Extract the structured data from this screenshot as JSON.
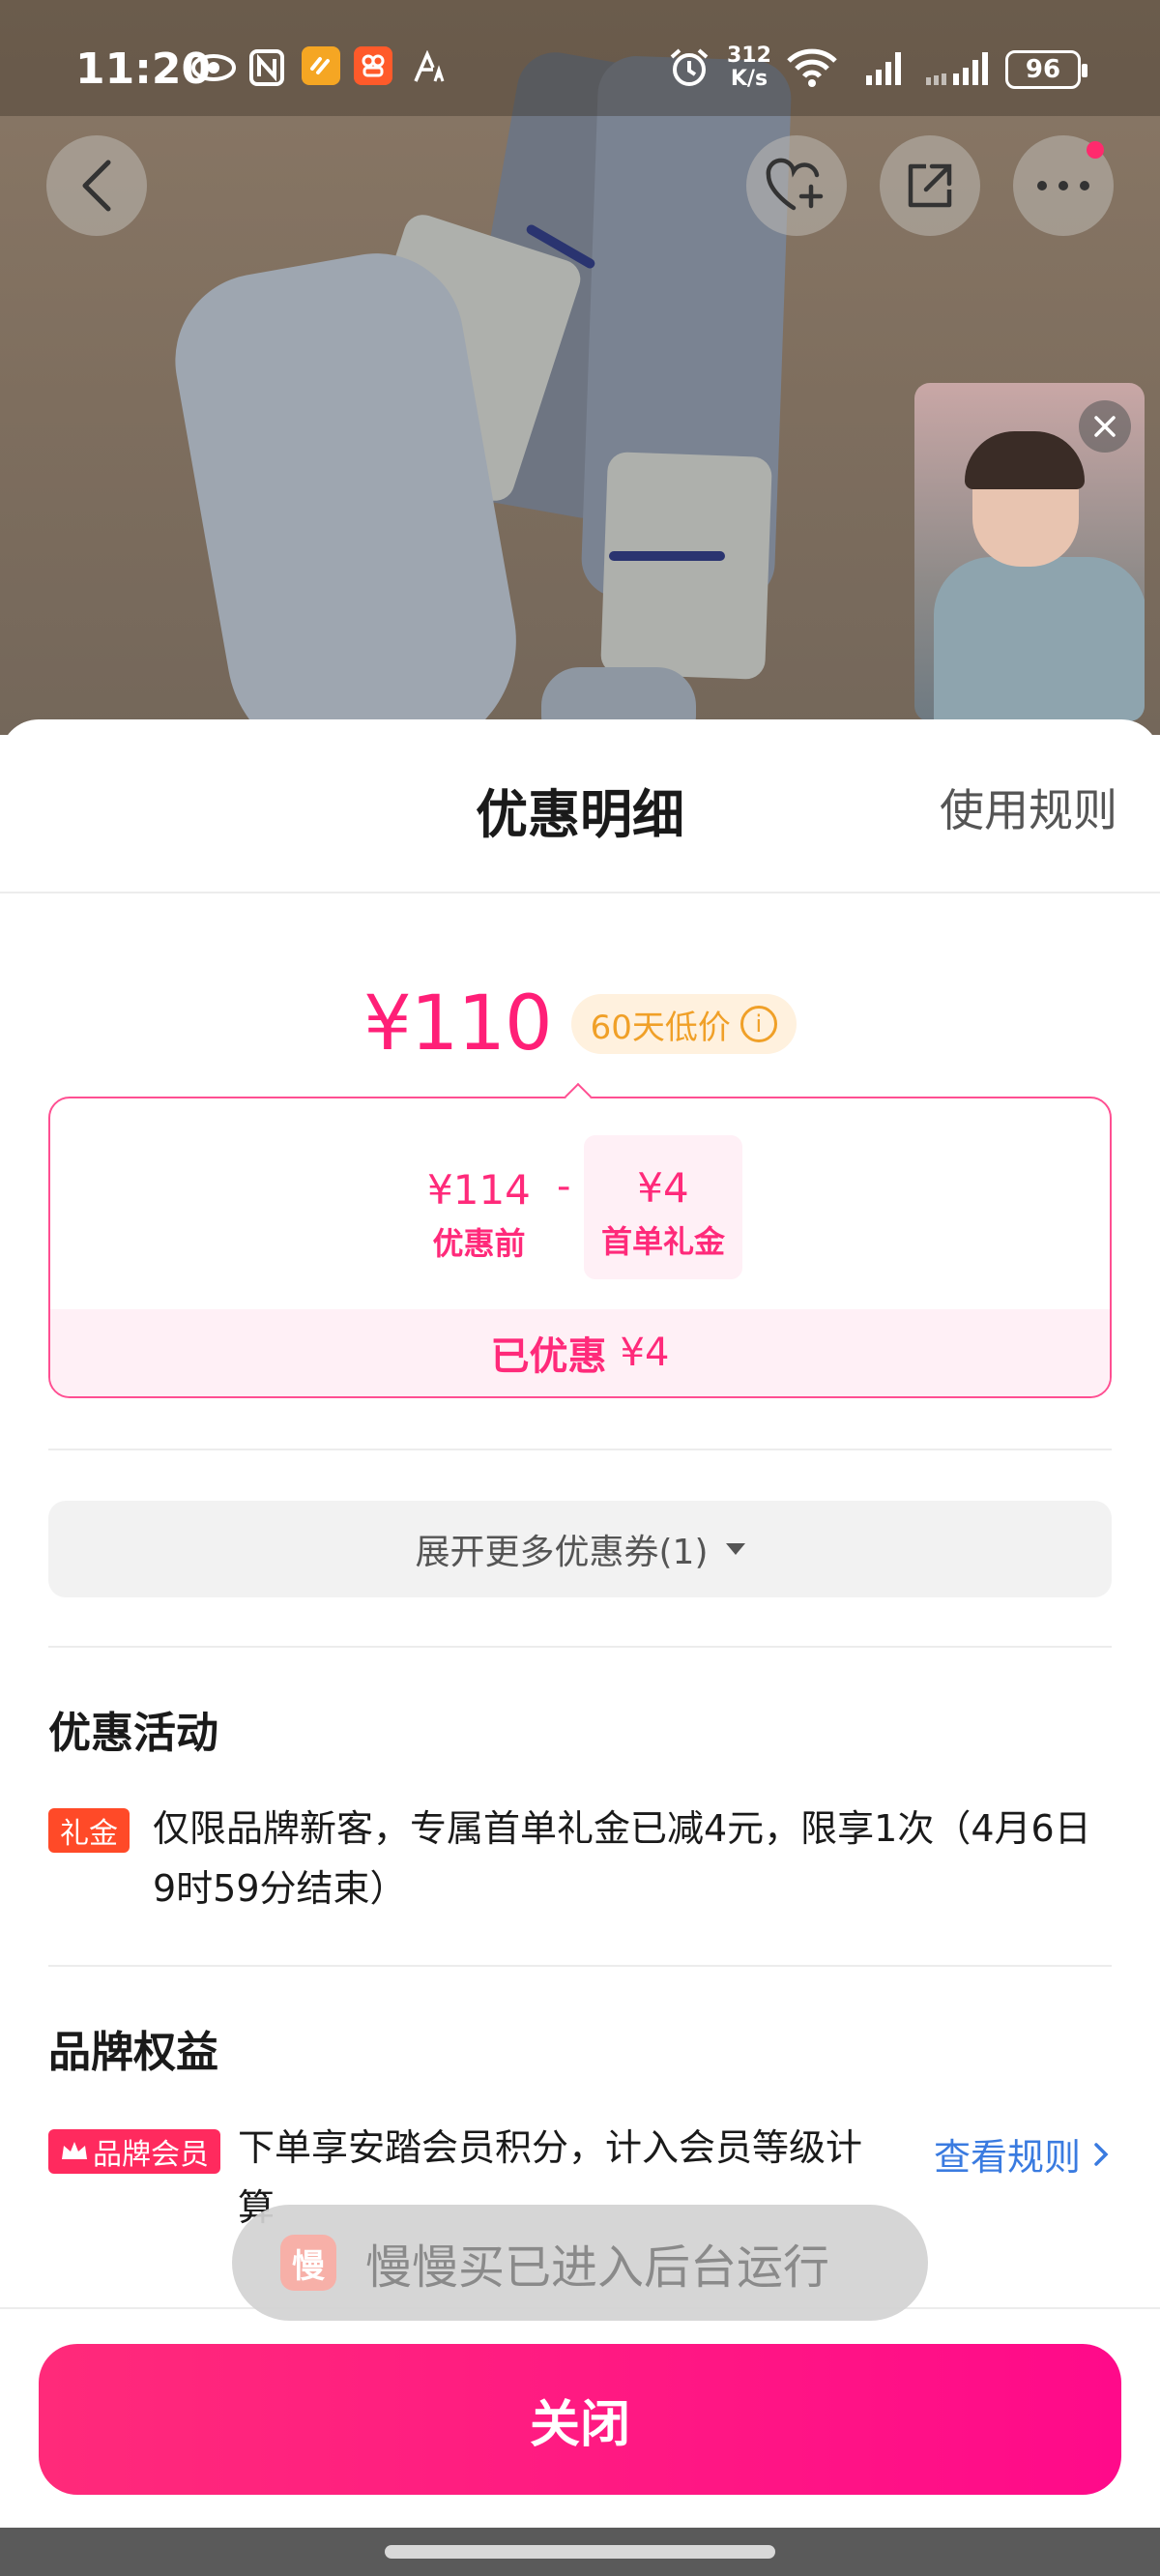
{
  "status_bar": {
    "time": "11:20",
    "net_speed_value": "312",
    "net_speed_unit": "K/s",
    "battery": "96"
  },
  "sheet": {
    "title": "优惠明细",
    "rules_link": "使用规则",
    "price": "¥110",
    "low_price_badge": "60天低价",
    "calc": {
      "original_amount": "¥114",
      "original_label": "优惠前",
      "operator": "-",
      "gift_amount": "¥4",
      "gift_label": "首单礼金",
      "saved_label": "已优惠",
      "saved_amount": "¥4"
    },
    "expand_more": "展开更多优惠券(1)",
    "activities": {
      "title": "优惠活动",
      "tag": "礼金",
      "desc_line1": "仅限品牌新客，专属首单礼金已减4元，限享1次（4月6日",
      "desc_line2": "9时59分结束）"
    },
    "brand": {
      "title": "品牌权益",
      "tag": "品牌会员",
      "desc_line1": "下单享安踏会员积分，计入会员等级计",
      "desc_line2": "算",
      "view_rules": "查看规则"
    },
    "close_button": "关闭"
  },
  "toast": {
    "text": "慢慢买已进入后台运行",
    "icon_char": "慢"
  },
  "colors": {
    "accent": "#ff1f77",
    "badge_orange": "#f0a028",
    "link_blue": "#3a7be0"
  }
}
